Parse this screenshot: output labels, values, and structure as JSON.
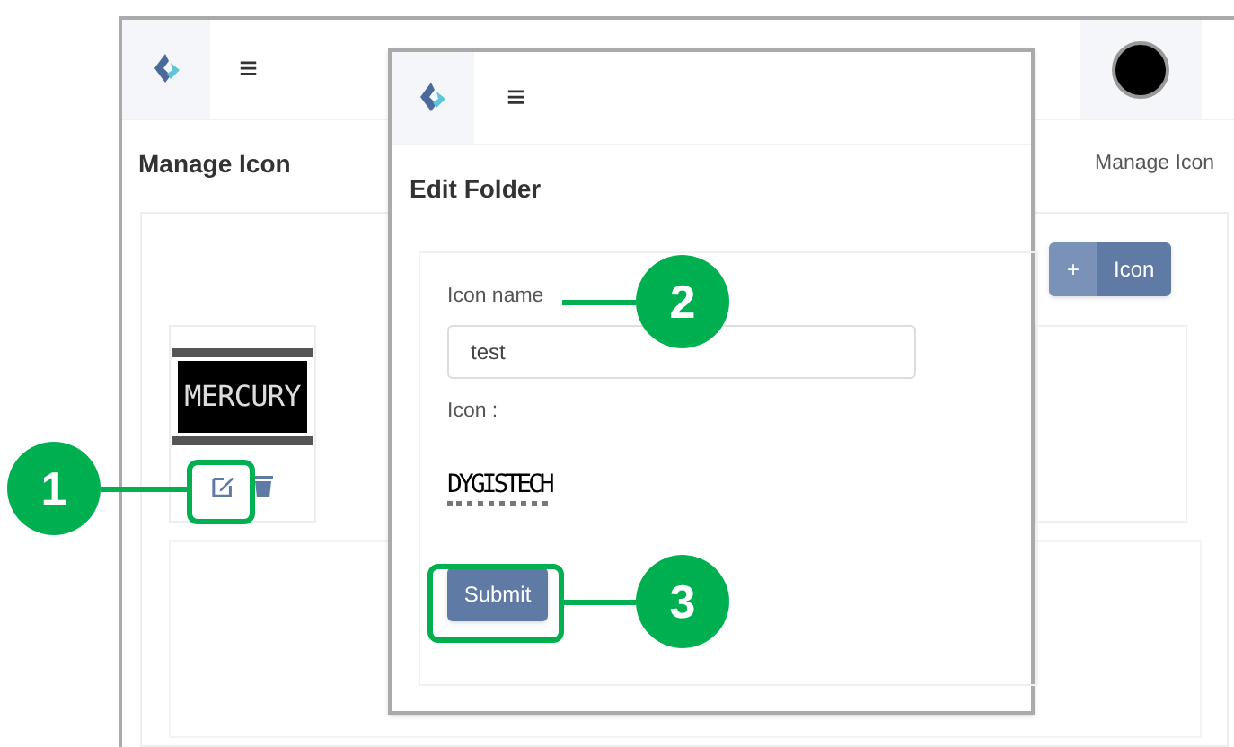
{
  "page": {
    "menu_icon": "≡",
    "title": "Manage Icon",
    "breadcrumb": "Manage Icon",
    "add_button": {
      "symbol": "+",
      "label": "Icon"
    },
    "icon_tiles": [
      {
        "logo_text": "MERCURY"
      }
    ]
  },
  "modal": {
    "menu_icon": "≡",
    "title": "Edit Folder",
    "name_label": "Icon name",
    "name_value": "test",
    "icon_label": "Icon :",
    "icon_logo_text": "DYGISTECH",
    "submit": "Submit"
  },
  "callouts": [
    {
      "number": "1"
    },
    {
      "number": "2"
    },
    {
      "number": "3"
    }
  ]
}
